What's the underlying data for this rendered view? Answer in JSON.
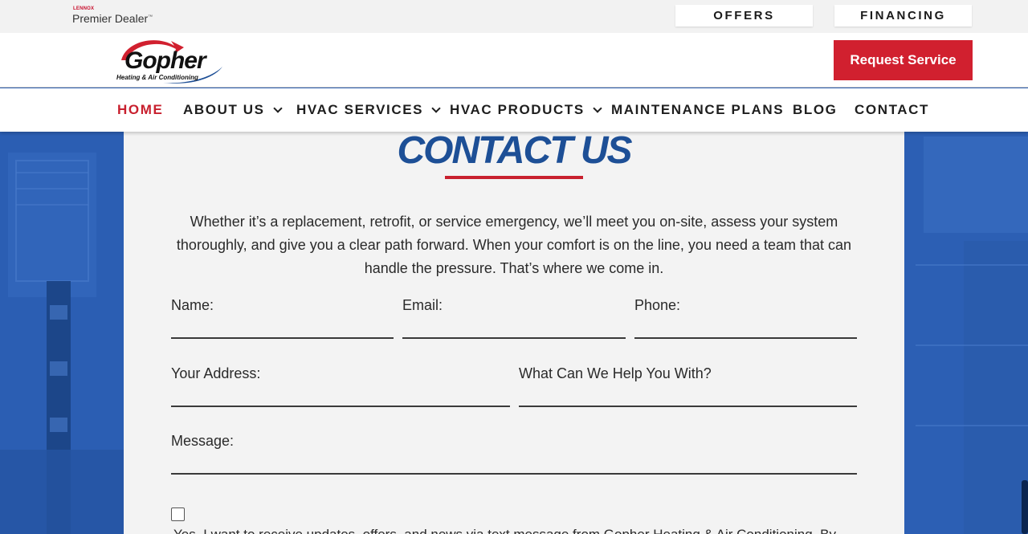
{
  "topbar": {
    "dealer_brand": "LENNOX",
    "dealer_label": "Premier Dealer",
    "dealer_tm": "™",
    "offers": "OFFERS",
    "financing": "FINANCING"
  },
  "header": {
    "logo_name": "Gopher",
    "logo_tagline": "Heating & Air Conditioning",
    "request_service": "Request Service"
  },
  "nav": {
    "items": [
      {
        "label": "HOME",
        "active": true
      },
      {
        "label": "ABOUT US",
        "dropdown": true
      },
      {
        "label": "HVAC SERVICES",
        "dropdown": true
      },
      {
        "label": "HVAC PRODUCTS",
        "dropdown": true
      },
      {
        "label": "MAINTENANCE PLANS"
      },
      {
        "label": "BLOG"
      },
      {
        "label": "CONTACT"
      }
    ]
  },
  "main": {
    "title": "CONTACT US",
    "intro": "Whether it’s a replacement, retrofit, or service emergency, we’ll meet you on-site, assess your system thoroughly, and give you a clear path forward. When your comfort is on the line, you need a team that can handle the pressure. That’s where we come in.",
    "form": {
      "name_label": "Name:",
      "email_label": "Email:",
      "phone_label": "Phone:",
      "address_label": "Your Address:",
      "help_label": "What Can We Help You With?",
      "message_label": "Message:",
      "consent_text": "Yes, I want to receive updates, offers, and news via text message from Gopher Heating & Air Conditioning. By"
    }
  },
  "colors": {
    "accent": "#c8202e",
    "brand_blue": "#1d4f96",
    "background_blue": "#2a5db0"
  }
}
